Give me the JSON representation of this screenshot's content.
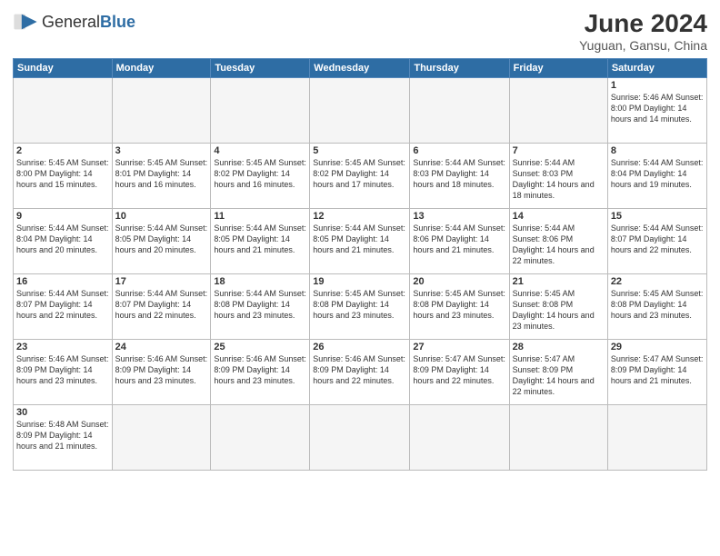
{
  "header": {
    "logo_general": "General",
    "logo_blue": "Blue",
    "month": "June 2024",
    "location": "Yuguan, Gansu, China"
  },
  "weekdays": [
    "Sunday",
    "Monday",
    "Tuesday",
    "Wednesday",
    "Thursday",
    "Friday",
    "Saturday"
  ],
  "weeks": [
    [
      {
        "day": "",
        "info": ""
      },
      {
        "day": "",
        "info": ""
      },
      {
        "day": "",
        "info": ""
      },
      {
        "day": "",
        "info": ""
      },
      {
        "day": "",
        "info": ""
      },
      {
        "day": "",
        "info": ""
      },
      {
        "day": "1",
        "info": "Sunrise: 5:46 AM\nSunset: 8:00 PM\nDaylight: 14 hours and 14 minutes."
      }
    ],
    [
      {
        "day": "2",
        "info": "Sunrise: 5:45 AM\nSunset: 8:00 PM\nDaylight: 14 hours and 15 minutes."
      },
      {
        "day": "3",
        "info": "Sunrise: 5:45 AM\nSunset: 8:01 PM\nDaylight: 14 hours and 16 minutes."
      },
      {
        "day": "4",
        "info": "Sunrise: 5:45 AM\nSunset: 8:02 PM\nDaylight: 14 hours and 16 minutes."
      },
      {
        "day": "5",
        "info": "Sunrise: 5:45 AM\nSunset: 8:02 PM\nDaylight: 14 hours and 17 minutes."
      },
      {
        "day": "6",
        "info": "Sunrise: 5:44 AM\nSunset: 8:03 PM\nDaylight: 14 hours and 18 minutes."
      },
      {
        "day": "7",
        "info": "Sunrise: 5:44 AM\nSunset: 8:03 PM\nDaylight: 14 hours and 18 minutes."
      },
      {
        "day": "8",
        "info": "Sunrise: 5:44 AM\nSunset: 8:04 PM\nDaylight: 14 hours and 19 minutes."
      }
    ],
    [
      {
        "day": "9",
        "info": "Sunrise: 5:44 AM\nSunset: 8:04 PM\nDaylight: 14 hours and 20 minutes."
      },
      {
        "day": "10",
        "info": "Sunrise: 5:44 AM\nSunset: 8:05 PM\nDaylight: 14 hours and 20 minutes."
      },
      {
        "day": "11",
        "info": "Sunrise: 5:44 AM\nSunset: 8:05 PM\nDaylight: 14 hours and 21 minutes."
      },
      {
        "day": "12",
        "info": "Sunrise: 5:44 AM\nSunset: 8:05 PM\nDaylight: 14 hours and 21 minutes."
      },
      {
        "day": "13",
        "info": "Sunrise: 5:44 AM\nSunset: 8:06 PM\nDaylight: 14 hours and 21 minutes."
      },
      {
        "day": "14",
        "info": "Sunrise: 5:44 AM\nSunset: 8:06 PM\nDaylight: 14 hours and 22 minutes."
      },
      {
        "day": "15",
        "info": "Sunrise: 5:44 AM\nSunset: 8:07 PM\nDaylight: 14 hours and 22 minutes."
      }
    ],
    [
      {
        "day": "16",
        "info": "Sunrise: 5:44 AM\nSunset: 8:07 PM\nDaylight: 14 hours and 22 minutes."
      },
      {
        "day": "17",
        "info": "Sunrise: 5:44 AM\nSunset: 8:07 PM\nDaylight: 14 hours and 22 minutes."
      },
      {
        "day": "18",
        "info": "Sunrise: 5:44 AM\nSunset: 8:08 PM\nDaylight: 14 hours and 23 minutes."
      },
      {
        "day": "19",
        "info": "Sunrise: 5:45 AM\nSunset: 8:08 PM\nDaylight: 14 hours and 23 minutes."
      },
      {
        "day": "20",
        "info": "Sunrise: 5:45 AM\nSunset: 8:08 PM\nDaylight: 14 hours and 23 minutes."
      },
      {
        "day": "21",
        "info": "Sunrise: 5:45 AM\nSunset: 8:08 PM\nDaylight: 14 hours and 23 minutes."
      },
      {
        "day": "22",
        "info": "Sunrise: 5:45 AM\nSunset: 8:08 PM\nDaylight: 14 hours and 23 minutes."
      }
    ],
    [
      {
        "day": "23",
        "info": "Sunrise: 5:46 AM\nSunset: 8:09 PM\nDaylight: 14 hours and 23 minutes."
      },
      {
        "day": "24",
        "info": "Sunrise: 5:46 AM\nSunset: 8:09 PM\nDaylight: 14 hours and 23 minutes."
      },
      {
        "day": "25",
        "info": "Sunrise: 5:46 AM\nSunset: 8:09 PM\nDaylight: 14 hours and 23 minutes."
      },
      {
        "day": "26",
        "info": "Sunrise: 5:46 AM\nSunset: 8:09 PM\nDaylight: 14 hours and 22 minutes."
      },
      {
        "day": "27",
        "info": "Sunrise: 5:47 AM\nSunset: 8:09 PM\nDaylight: 14 hours and 22 minutes."
      },
      {
        "day": "28",
        "info": "Sunrise: 5:47 AM\nSunset: 8:09 PM\nDaylight: 14 hours and 22 minutes."
      },
      {
        "day": "29",
        "info": "Sunrise: 5:47 AM\nSunset: 8:09 PM\nDaylight: 14 hours and 21 minutes."
      }
    ],
    [
      {
        "day": "30",
        "info": "Sunrise: 5:48 AM\nSunset: 8:09 PM\nDaylight: 14 hours and 21 minutes."
      },
      {
        "day": "",
        "info": ""
      },
      {
        "day": "",
        "info": ""
      },
      {
        "day": "",
        "info": ""
      },
      {
        "day": "",
        "info": ""
      },
      {
        "day": "",
        "info": ""
      },
      {
        "day": "",
        "info": ""
      }
    ]
  ]
}
